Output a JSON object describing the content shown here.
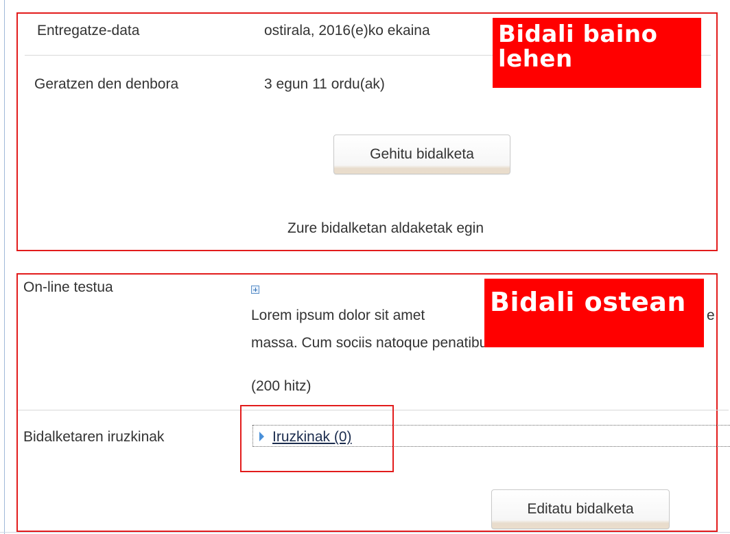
{
  "submission_before": {
    "due_date_label": "Entregatze-data",
    "due_date_value": "ostirala, 2016(e)ko ekaina",
    "time_remaining_label": "Geratzen den denbora",
    "time_remaining_value": "3 egun 11 ordu(ak)",
    "add_submission_button": "Gehitu bidalketa",
    "make_changes_text": "Zure bidalketan aldaketak egin",
    "callout_line1": "Bidali baino",
    "callout_line2": "lehen"
  },
  "submission_after": {
    "online_text_label": "On-line testua",
    "lorem_line1": "Lorem ipsum dolor sit amet",
    "lorem_line1_tail": "e",
    "lorem_line2": "massa. Cum sociis natoque penatibus et m",
    "word_count": "(200 hitz)",
    "comments_label": "Bidalketaren iruzkinak",
    "comments_link": "Iruzkinak (0)",
    "edit_submission_button": "Editatu bidalketa",
    "callout": "Bidali ostean"
  },
  "icons": {
    "expand": "plus-square-icon",
    "disclosure": "triangle-right-icon"
  },
  "colors": {
    "annotation_red": "#ff0000",
    "frame_red": "#e21b1b",
    "text": "#333333",
    "link": "#1b2c4e",
    "accent_blue": "#4a90d9"
  }
}
